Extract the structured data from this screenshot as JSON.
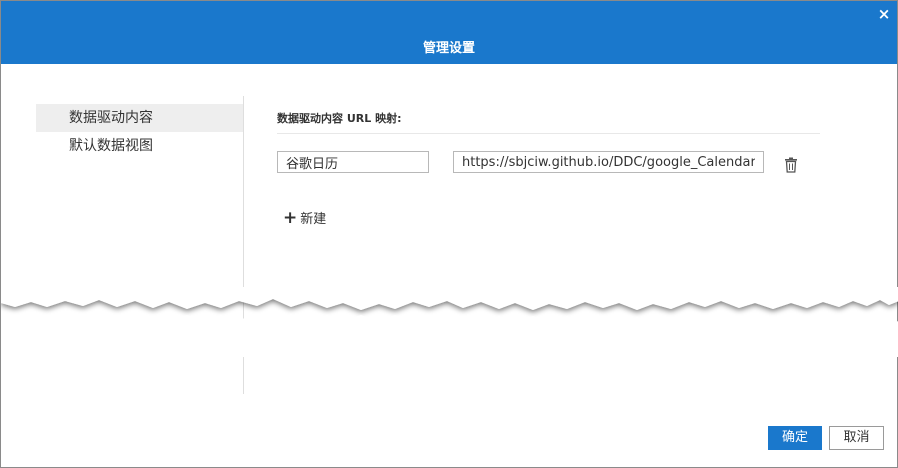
{
  "dialog": {
    "title": "管理设置",
    "close_glyph": "×"
  },
  "sidebar": {
    "items": [
      {
        "label": "数据驱动内容",
        "active": true
      },
      {
        "label": "默认数据视图",
        "active": false
      }
    ]
  },
  "content": {
    "section_label": "数据驱动内容 URL 映射:",
    "mappings": [
      {
        "name": "谷歌日历",
        "url": "https://sbjciw.github.io/DDC/google_Calendar"
      }
    ],
    "delete_icon": "trash-icon",
    "new_label": "新建",
    "new_icon": "plus-icon"
  },
  "footer": {
    "ok_label": "确定",
    "cancel_label": "取消"
  },
  "colors": {
    "accent": "#1a78cc",
    "sidebar_active_bg": "#eeeeee"
  }
}
